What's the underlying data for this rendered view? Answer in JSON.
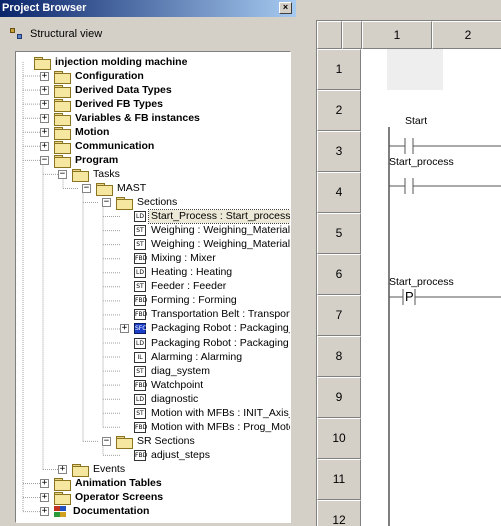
{
  "project_browser": {
    "title": "Project Browser",
    "close_glyph": "×",
    "view_label": "Structural view",
    "tree": [
      {
        "label": "injection molding machine",
        "bold": true,
        "icon": "folder-open-icon",
        "toggle": ""
      },
      {
        "label": "Configuration",
        "bold": true,
        "icon": "folder-icon",
        "toggle": "+"
      },
      {
        "label": "Derived Data Types",
        "bold": true,
        "icon": "folder-icon",
        "toggle": "+"
      },
      {
        "label": "Derived FB Types",
        "bold": true,
        "icon": "folder-icon",
        "toggle": "+"
      },
      {
        "label": "Variables & FB instances",
        "bold": true,
        "icon": "folder-icon",
        "toggle": "+"
      },
      {
        "label": "Motion",
        "bold": true,
        "icon": "folder-icon",
        "toggle": "+"
      },
      {
        "label": "Communication",
        "bold": true,
        "icon": "folder-icon",
        "toggle": "+"
      },
      {
        "label": "Program",
        "bold": true,
        "icon": "folder-open-icon",
        "toggle": "−"
      },
      {
        "label": "Tasks",
        "bold": false,
        "icon": "folder-open-icon",
        "toggle": "−"
      },
      {
        "label": "MAST",
        "bold": false,
        "icon": "folder-open-icon",
        "toggle": "−"
      },
      {
        "label": "Sections",
        "bold": false,
        "icon": "folder-open-icon",
        "toggle": "−"
      },
      {
        "label": "Start_Process : Start_process",
        "bold": false,
        "icon": "LD",
        "toggle": "",
        "selected": true
      },
      {
        "label": "Weighing : Weighing_Material_",
        "bold": false,
        "icon": "ST",
        "toggle": ""
      },
      {
        "label": "Weighing : Weighing_Material_",
        "bold": false,
        "icon": "ST",
        "toggle": ""
      },
      {
        "label": "Mixing : Mixer",
        "bold": false,
        "icon": "FBD",
        "toggle": ""
      },
      {
        "label": "Heating : Heating",
        "bold": false,
        "icon": "LD",
        "toggle": ""
      },
      {
        "label": "Feeder : Feeder",
        "bold": false,
        "icon": "ST",
        "toggle": ""
      },
      {
        "label": "Forming : Forming",
        "bold": false,
        "icon": "FBD",
        "toggle": ""
      },
      {
        "label": "Transportation Belt : Transport",
        "bold": false,
        "icon": "FBD",
        "toggle": ""
      },
      {
        "label": "Packaging Robot : Packaging_F",
        "bold": false,
        "icon": "SFC",
        "toggle": "+"
      },
      {
        "label": "Packaging Robot : Packaging",
        "bold": false,
        "icon": "LD",
        "toggle": ""
      },
      {
        "label": "Alarming : Alarming",
        "bold": false,
        "icon": "IL",
        "toggle": ""
      },
      {
        "label": "diag_system",
        "bold": false,
        "icon": "ST",
        "toggle": ""
      },
      {
        "label": "Watchpoint",
        "bold": false,
        "icon": "FBD",
        "toggle": ""
      },
      {
        "label": "diagnostic",
        "bold": false,
        "icon": "LD",
        "toggle": ""
      },
      {
        "label": "Motion with MFBs : INIT_Axis_I",
        "bold": false,
        "icon": "ST",
        "toggle": ""
      },
      {
        "label": "Motion with MFBs : Prog_Motor",
        "bold": false,
        "icon": "FBD",
        "toggle": ""
      },
      {
        "label": "SR Sections",
        "bold": false,
        "icon": "folder-open-icon",
        "toggle": "−"
      },
      {
        "label": "adjust_steps",
        "bold": false,
        "icon": "FBD",
        "toggle": ""
      },
      {
        "label": "Events",
        "bold": false,
        "icon": "folder-icon",
        "toggle": "+"
      },
      {
        "label": "Animation Tables",
        "bold": true,
        "icon": "folder-icon",
        "toggle": "+"
      },
      {
        "label": "Operator Screens",
        "bold": true,
        "icon": "folder-icon",
        "toggle": "+"
      },
      {
        "label": "Documentation",
        "bold": true,
        "icon": "documentation-icon",
        "toggle": "+"
      }
    ]
  },
  "ladder_editor": {
    "column_headers": [
      "1",
      "2"
    ],
    "row_headers": [
      "1",
      "2",
      "3",
      "4",
      "5",
      "6",
      "7",
      "8",
      "9",
      "10",
      "11",
      "12"
    ],
    "contacts": [
      {
        "label": "Start",
        "row": 2,
        "type": "normally-open"
      },
      {
        "label": "Start_process",
        "row": 3,
        "type": "normally-open"
      },
      {
        "label": "Start_process",
        "row": 6,
        "type": "positive-transition",
        "glyph": "P"
      }
    ]
  },
  "colors": {
    "title_bar": "#0a246a",
    "panel_bg": "#d4d0c8",
    "sfc_icon": "#1a3ec8"
  }
}
